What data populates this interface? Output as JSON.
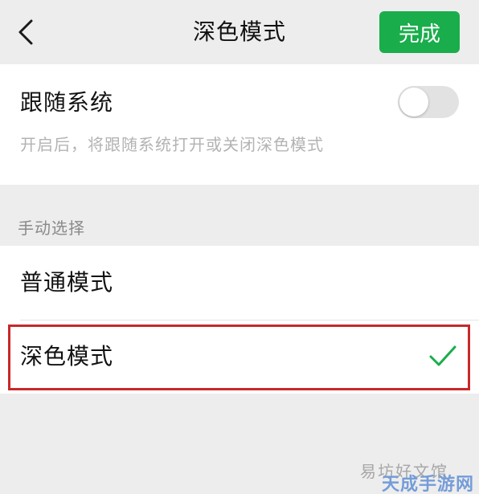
{
  "header": {
    "title": "深色模式",
    "back_icon": "chevron-left-icon",
    "done_label": "完成"
  },
  "follow_system": {
    "label": "跟随系统",
    "description": "开启后，将跟随系统打开或关闭深色模式",
    "enabled": false
  },
  "manual": {
    "section_label": "手动选择",
    "options": [
      {
        "label": "普通模式",
        "selected": false
      },
      {
        "label": "深色模式",
        "selected": true,
        "icon": "check-icon"
      }
    ]
  },
  "watermark": {
    "line1": "易坊好文馆",
    "line2": "天成手游网"
  },
  "colors": {
    "accent": "#1aad4c",
    "check": "#1aad4c",
    "highlight": "#c8282a",
    "background": "#ededed"
  }
}
